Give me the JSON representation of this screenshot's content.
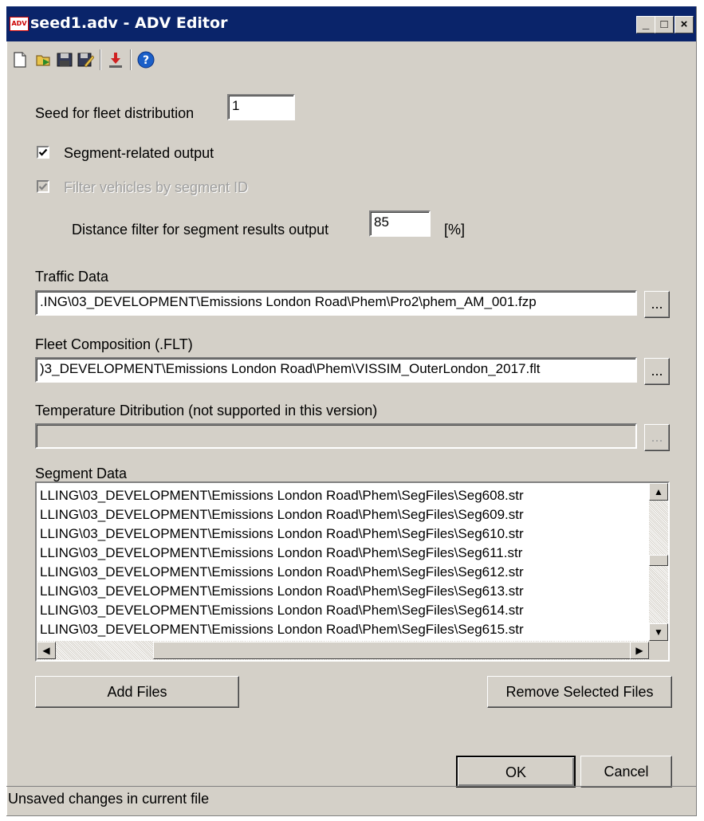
{
  "window": {
    "title": "seed1.adv - ADV Editor",
    "app_icon_text": "ADV"
  },
  "titlebar_buttons": {
    "minimize": "_",
    "maximize": "□",
    "close": "×"
  },
  "toolbar": {
    "icons": [
      "new-file-icon",
      "open-folder-icon",
      "save-icon",
      "save-as-icon",
      "export-icon",
      "help-icon"
    ],
    "help_glyph": "?"
  },
  "form": {
    "seed_label": "Seed for fleet distribution",
    "seed_value": "1",
    "segment_output_label": "Segment-related output",
    "segment_output_checked": true,
    "filter_vehicles_label": "Filter vehicles by segment ID",
    "filter_vehicles_checked": true,
    "distance_filter_label": "Distance filter for segment results output",
    "distance_filter_value": "85",
    "distance_filter_unit": "[%]",
    "traffic_label": "Traffic Data",
    "traffic_value": ".ING\\03_DEVELOPMENT\\Emissions London Road\\Phem\\Pro2\\phem_AM_001.fzp",
    "fleet_label": "Fleet Composition (.FLT)",
    "fleet_value": ")3_DEVELOPMENT\\Emissions London Road\\Phem\\VISSIM_OuterLondon_2017.flt",
    "temperature_label": "Temperature Ditribution (not supported in this version)",
    "temperature_value": "",
    "browse_label": "...",
    "segment_label": "Segment Data"
  },
  "segment_files": [
    "LLING\\03_DEVELOPMENT\\Emissions London Road\\Phem\\SegFiles\\Seg608.str",
    "LLING\\03_DEVELOPMENT\\Emissions London Road\\Phem\\SegFiles\\Seg609.str",
    "LLING\\03_DEVELOPMENT\\Emissions London Road\\Phem\\SegFiles\\Seg610.str",
    "LLING\\03_DEVELOPMENT\\Emissions London Road\\Phem\\SegFiles\\Seg611.str",
    "LLING\\03_DEVELOPMENT\\Emissions London Road\\Phem\\SegFiles\\Seg612.str",
    "LLING\\03_DEVELOPMENT\\Emissions London Road\\Phem\\SegFiles\\Seg613.str",
    "LLING\\03_DEVELOPMENT\\Emissions London Road\\Phem\\SegFiles\\Seg614.str",
    "LLING\\03_DEVELOPMENT\\Emissions London Road\\Phem\\SegFiles\\Seg615.str"
  ],
  "scroll_arrows": {
    "up": "▲",
    "down": "▼",
    "left": "◀",
    "right": "▶"
  },
  "buttons": {
    "add_files": "Add Files",
    "remove_selected": "Remove Selected Files",
    "ok": "OK",
    "cancel": "Cancel"
  },
  "status": {
    "text": "Unsaved changes in current file"
  },
  "colors": {
    "titlebar": "#0a246a",
    "face": "#d4d0c8",
    "disabled_text": "#a0a0a0"
  }
}
